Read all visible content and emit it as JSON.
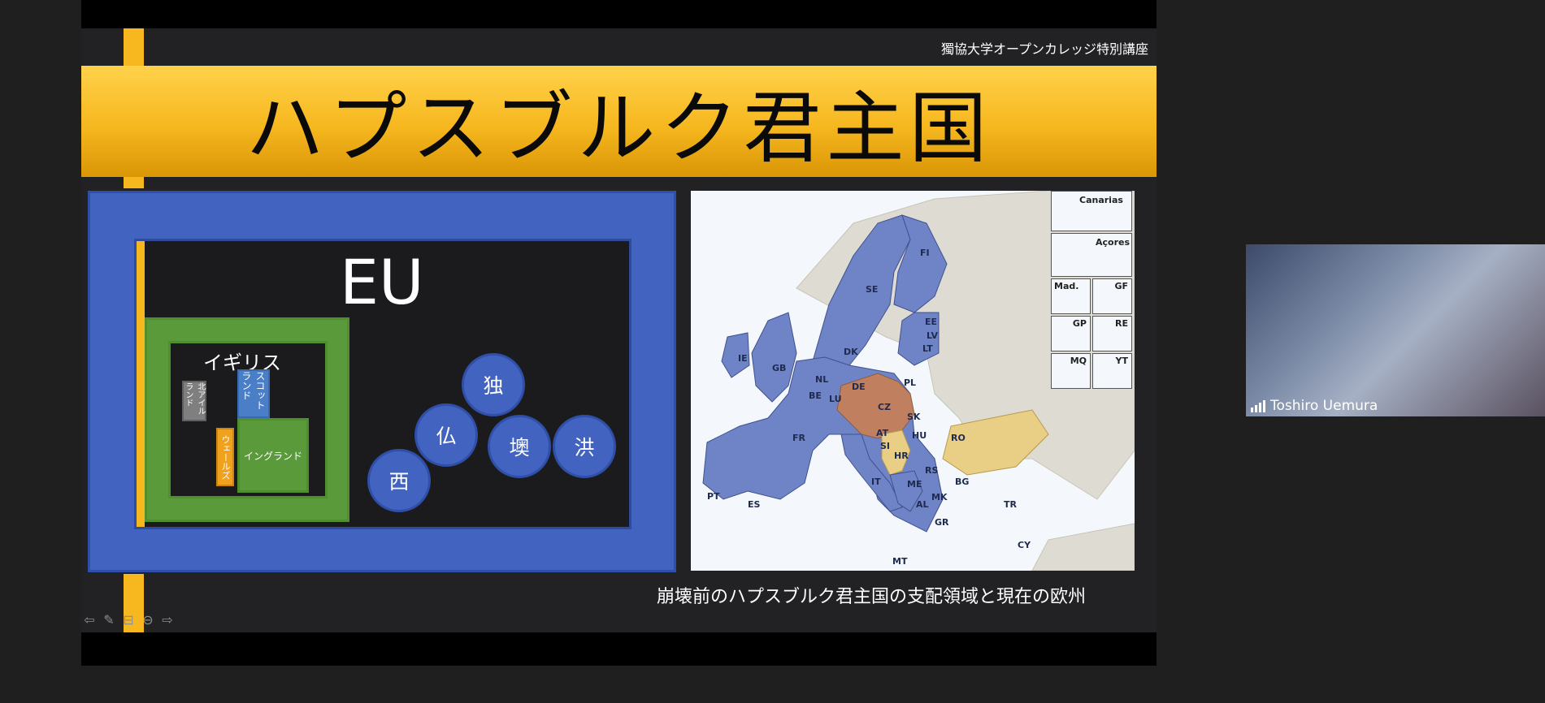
{
  "slide": {
    "header": "獨協大学オープンカレッジ特別講座",
    "title": "ハプスブルク君主国",
    "caption": "崩壊前のハプスブルク君主国の支配領域と現在の欧州"
  },
  "diagram": {
    "eu_label": "EU",
    "uk_label": "イギリス",
    "uk_parts": {
      "northern_ireland": "北アイルランド",
      "scotland": "スコットランド",
      "wales": "ウェールズ",
      "england": "イングランド"
    },
    "countries": [
      "独",
      "仏",
      "西",
      "墺",
      "洪"
    ]
  },
  "map": {
    "insets": [
      "Canarias",
      "Açores",
      "Mad.",
      "GF",
      "GP",
      "RE",
      "MQ",
      "YT"
    ],
    "country_codes": [
      "FI",
      "SE",
      "EE",
      "LV",
      "LT",
      "IE",
      "GB",
      "DK",
      "NL",
      "BE",
      "LU",
      "DE",
      "PL",
      "CZ",
      "SK",
      "AT",
      "HU",
      "SI",
      "HR",
      "RO",
      "FR",
      "IT",
      "ES",
      "PT",
      "RS",
      "BG",
      "ME",
      "MK",
      "AL",
      "GR",
      "TR",
      "CY",
      "MT"
    ],
    "colors": {
      "eu": "#6f84c6",
      "habsburg": "#c08060",
      "candidate": "#e8cf85",
      "other": "#dedbd2",
      "sea": "#f4f7fb"
    }
  },
  "participant": {
    "name": "Toshiro Uemura",
    "signal_icon": "signal-bars-icon"
  }
}
